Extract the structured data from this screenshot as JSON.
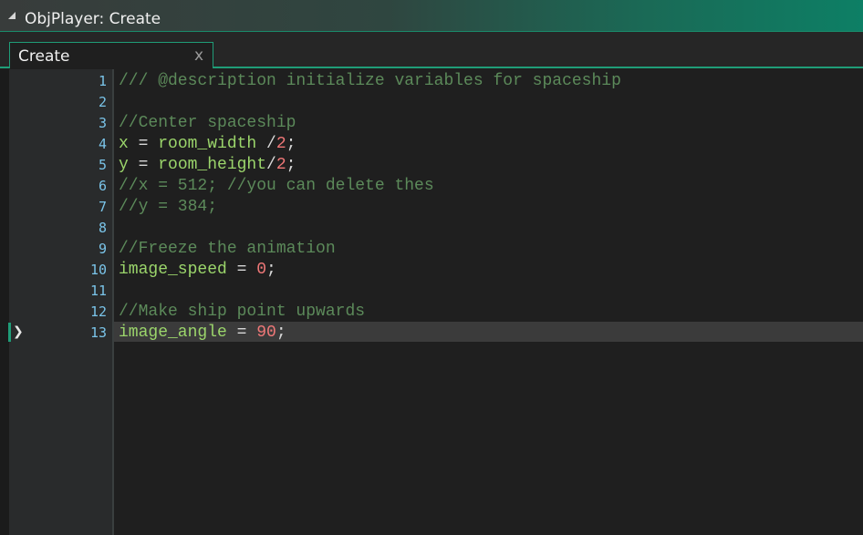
{
  "window": {
    "title": "ObjPlayer: Create"
  },
  "tab": {
    "label": "Create",
    "close": "x"
  },
  "lines": [
    {
      "num": "1",
      "tokens": [
        {
          "t": "comment",
          "v": "/// @description initialize variables for spaceship"
        }
      ]
    },
    {
      "num": "2",
      "tokens": []
    },
    {
      "num": "3",
      "tokens": [
        {
          "t": "comment",
          "v": "//Center spaceship"
        }
      ]
    },
    {
      "num": "4",
      "tokens": [
        {
          "t": "var",
          "v": "x"
        },
        {
          "t": "op",
          "v": " = "
        },
        {
          "t": "var",
          "v": "room_width"
        },
        {
          "t": "op",
          "v": " /"
        },
        {
          "t": "num",
          "v": "2"
        },
        {
          "t": "op",
          "v": ";"
        }
      ]
    },
    {
      "num": "5",
      "tokens": [
        {
          "t": "var",
          "v": "y"
        },
        {
          "t": "op",
          "v": " = "
        },
        {
          "t": "var",
          "v": "room_height"
        },
        {
          "t": "op",
          "v": "/"
        },
        {
          "t": "num",
          "v": "2"
        },
        {
          "t": "op",
          "v": ";"
        }
      ]
    },
    {
      "num": "6",
      "tokens": [
        {
          "t": "comment",
          "v": "//x = 512; //you can delete thes"
        }
      ]
    },
    {
      "num": "7",
      "tokens": [
        {
          "t": "comment",
          "v": "//y = 384;"
        }
      ]
    },
    {
      "num": "8",
      "tokens": []
    },
    {
      "num": "9",
      "tokens": [
        {
          "t": "comment",
          "v": "//Freeze the animation"
        }
      ]
    },
    {
      "num": "10",
      "tokens": [
        {
          "t": "var",
          "v": "image_speed"
        },
        {
          "t": "op",
          "v": " = "
        },
        {
          "t": "num",
          "v": "0"
        },
        {
          "t": "op",
          "v": ";"
        }
      ]
    },
    {
      "num": "11",
      "tokens": []
    },
    {
      "num": "12",
      "tokens": [
        {
          "t": "comment",
          "v": "//Make ship point upwards"
        }
      ]
    },
    {
      "num": "13",
      "tokens": [
        {
          "t": "var",
          "v": "image_angle"
        },
        {
          "t": "op",
          "v": " = "
        },
        {
          "t": "num",
          "v": "90"
        },
        {
          "t": "op",
          "v": ";"
        }
      ]
    }
  ],
  "current_line": "13",
  "colors": {
    "comment": "#5c8a5a",
    "variable": "#9bd56b",
    "number": "#f07878",
    "line_number": "#7ac4e9",
    "accent": "#1f9d78"
  }
}
